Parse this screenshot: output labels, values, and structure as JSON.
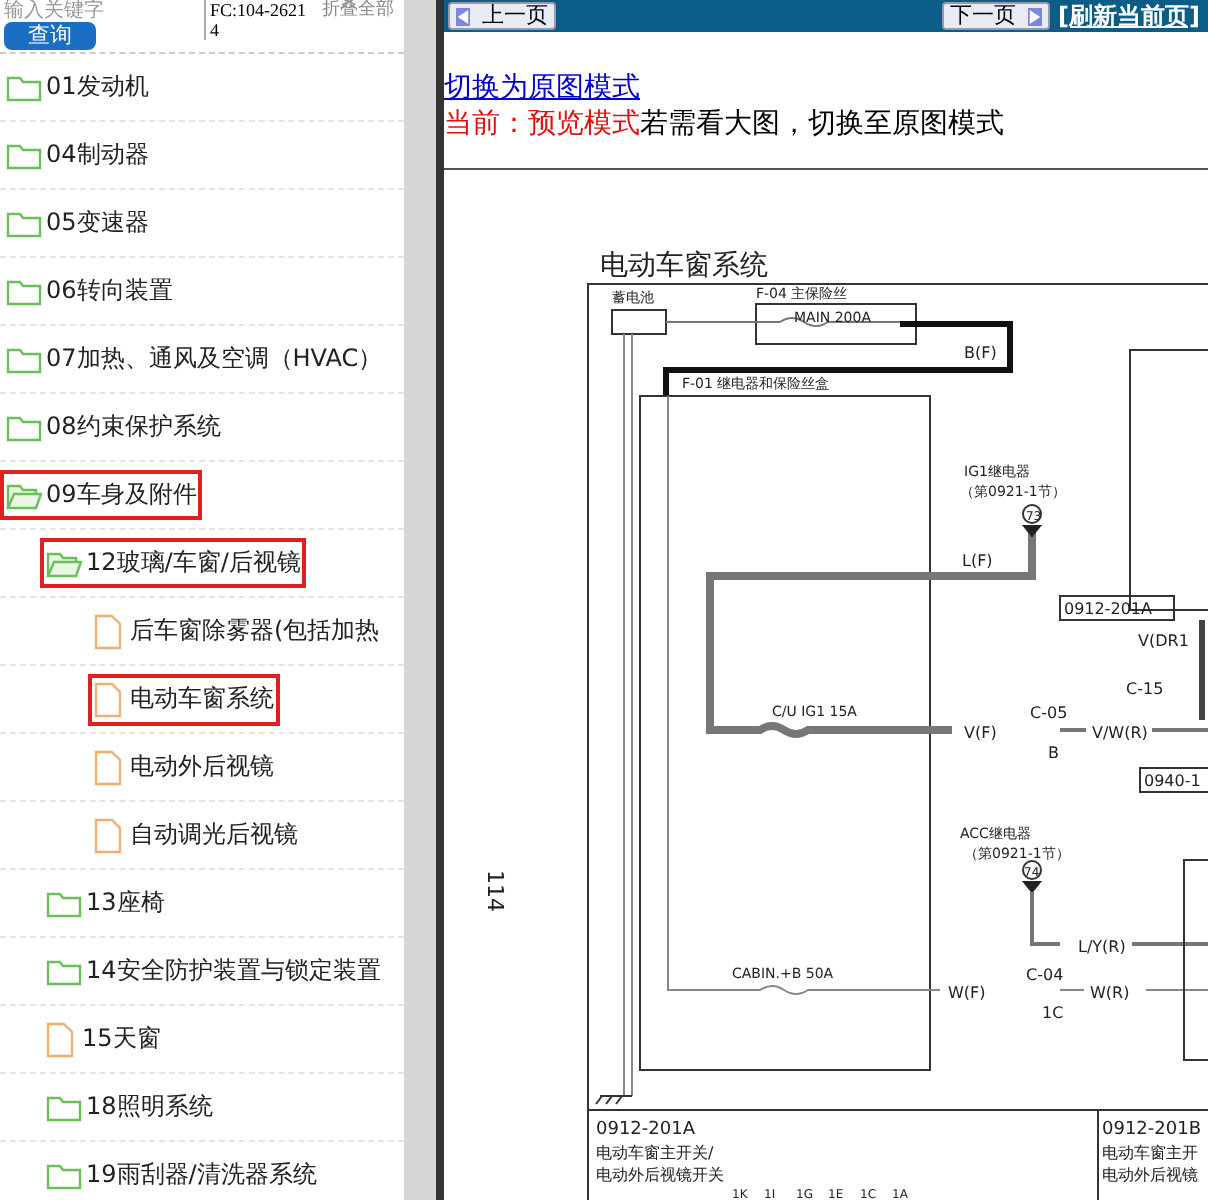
{
  "sidebar": {
    "search": {
      "placeholder": "输入关键字"
    },
    "search_button": "查询",
    "code": "FC:104-26214",
    "collapse_all": "折叠全部",
    "tree": [
      {
        "label": "01发动机",
        "kind": "folder",
        "expanded": false,
        "highlighted": false
      },
      {
        "label": "04制动器",
        "kind": "folder",
        "expanded": false,
        "highlighted": false
      },
      {
        "label": "05变速器",
        "kind": "folder",
        "expanded": false,
        "highlighted": false
      },
      {
        "label": "06转向装置",
        "kind": "folder",
        "expanded": false,
        "highlighted": false
      },
      {
        "label": "07加热、通风及空调（HVAC）",
        "kind": "folder",
        "expanded": false,
        "highlighted": false
      },
      {
        "label": "08约束保护系统",
        "kind": "folder",
        "expanded": false,
        "highlighted": false
      },
      {
        "label": "09车身及附件",
        "kind": "folder",
        "expanded": true,
        "highlighted": true,
        "children": [
          {
            "label": "12玻璃/车窗/后视镜",
            "kind": "folder",
            "expanded": true,
            "highlighted": true,
            "children": [
              {
                "label": "后车窗除雾器(包括加热",
                "kind": "document",
                "highlighted": false
              },
              {
                "label": "电动车窗系统",
                "kind": "document",
                "highlighted": true
              },
              {
                "label": "电动外后视镜",
                "kind": "document",
                "highlighted": false
              },
              {
                "label": "自动调光后视镜",
                "kind": "document",
                "highlighted": false
              }
            ]
          },
          {
            "label": "13座椅",
            "kind": "folder",
            "expanded": false,
            "highlighted": false
          },
          {
            "label": "14安全防护装置与锁定装置",
            "kind": "folder",
            "expanded": false,
            "highlighted": false
          },
          {
            "label": "15天窗",
            "kind": "document",
            "highlighted": false
          },
          {
            "label": "18照明系统",
            "kind": "folder",
            "expanded": false,
            "highlighted": false
          },
          {
            "label": "19雨刮器/清洗器系统",
            "kind": "folder",
            "expanded": false,
            "highlighted": false
          }
        ]
      }
    ]
  },
  "viewer": {
    "prev_button": "上一页",
    "next_button": "下一页",
    "refresh_link": "[刷新当前页]",
    "mode_link": "切换为原图模式",
    "mode_status": "当前：预览模式",
    "mode_hint": "若需看大图，切换至原图模式",
    "diagram": {
      "title": "电动车窗系统",
      "page_number": "114",
      "labels": [
        "蓄电池",
        "F-04 主保险丝",
        "MAIN 200A",
        "B(F)",
        "F-01 继电器和保险丝盒",
        "IG1继电器",
        "（第0921-1节）",
        "73",
        "L(F)",
        "0912-201A",
        "V(DR1",
        "C-15",
        "C/U IG1 15A",
        "C-05",
        "V(F)",
        "V/W(R)",
        "B",
        "0940-1",
        "ACC继电器",
        "（第0921-1节）",
        "74",
        "L/Y(R)",
        "CABIN.+B 50A",
        "C-04",
        "W(F)",
        "W(R)",
        "1C"
      ],
      "parts": [
        {
          "code": "0912-201A",
          "lines": [
            "电动车窗主开关/",
            "电动外后视镜开关"
          ],
          "pins": [
            "1K",
            "1I",
            "1G",
            "1E",
            "1C",
            "1A"
          ]
        },
        {
          "code": "0912-201B",
          "lines": [
            "电动车窗主开",
            "电动外后视镜"
          ]
        }
      ]
    }
  }
}
